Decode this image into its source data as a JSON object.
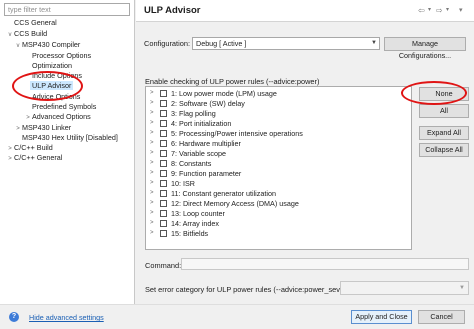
{
  "filter": {
    "placeholder": "type filter text"
  },
  "tree": [
    {
      "label": "CCS General",
      "expander": ""
    },
    {
      "label": "CCS Build",
      "expander": "v"
    },
    {
      "label": "MSP430 Compiler",
      "expander": "v"
    },
    {
      "label": "Processor Options",
      "expander": ""
    },
    {
      "label": "Optimization",
      "expander": ""
    },
    {
      "label": "Include Options",
      "expander": ""
    },
    {
      "label": "ULP Advisor",
      "expander": "",
      "selected": true
    },
    {
      "label": "Advice Options",
      "expander": ""
    },
    {
      "label": "Predefined Symbols",
      "expander": ""
    },
    {
      "label": "Advanced Options",
      "expander": ">"
    },
    {
      "label": "MSP430 Linker",
      "expander": ">"
    },
    {
      "label": "MSP430 Hex Utility  [Disabled]",
      "expander": ""
    },
    {
      "label": "C/C++ Build",
      "expander": ">"
    },
    {
      "label": "C/C++ General",
      "expander": ">"
    }
  ],
  "header": {
    "title": "ULP Advisor",
    "nav": {
      "back": "⇦",
      "back_menu": "▾",
      "forward": "⇨",
      "forward_menu": "▾",
      "menu": "▾"
    }
  },
  "configuration": {
    "label": "Configuration:",
    "value": "Debug  [ Active ]",
    "arrow": "▼",
    "manage_button": "Manage Configurations..."
  },
  "rules": {
    "heading": "Enable checking of ULP power rules (--advice:power)",
    "items": [
      "1: Low power mode (LPM) usage",
      "2: Software (SW) delay",
      "3: Flag polling",
      "4: Port initialization",
      "5: Processing/Power intensive operations",
      "6: Hardware multiplier",
      "7: Variable scope",
      "8: Constants",
      "9: Function parameter",
      "10: ISR",
      "11: Constant generator utilization",
      "12: Direct Memory Access (DMA) usage",
      "13: Loop counter",
      "14: Array index",
      "15: Bitfields"
    ],
    "expander": ">",
    "buttons": {
      "none": "None",
      "all": "All",
      "expand_all": "Expand All",
      "collapse_all": "Collapse All"
    }
  },
  "command": {
    "label": "Command:",
    "value": ""
  },
  "severity": {
    "label": "Set error category for ULP power rules (--advice:power_severity)",
    "value": "",
    "arrow": "▼"
  },
  "footer": {
    "help": "?",
    "advanced_link": "Hide advanced settings",
    "apply_close": "Apply and Close",
    "cancel": "Cancel"
  },
  "colors": {
    "annotation": "#e01414",
    "selection": "#cce8ff",
    "link": "#1a5fb4",
    "help_icon": "#3d7bd8"
  }
}
